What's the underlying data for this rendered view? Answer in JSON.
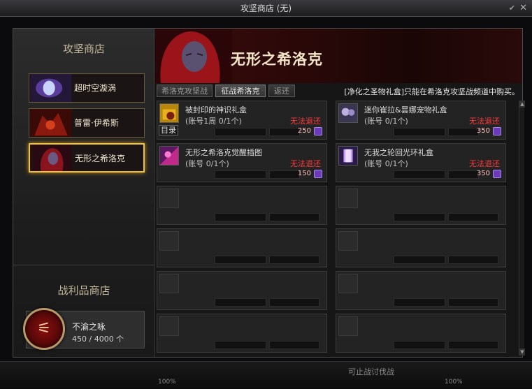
{
  "window": {
    "title": "攻坚商店 (无)"
  },
  "sidebar": {
    "heading": "攻坚商店",
    "shops": [
      {
        "label": "超时空漩涡",
        "active": false
      },
      {
        "label": "普雷·伊希斯",
        "active": false
      },
      {
        "label": "无形之希洛克",
        "active": true
      }
    ],
    "loot_heading": "战利品商店",
    "currency": {
      "name": "不渝之咏",
      "count": "450 / 4000 个"
    }
  },
  "main": {
    "banner_title": "无形之希洛克",
    "tabs": [
      {
        "label": "希洛克攻坚战",
        "active": false
      },
      {
        "label": "征战希洛克",
        "active": true
      },
      {
        "label": "返还",
        "active": false
      }
    ],
    "notice": "[净化之圣物礼盒]只能在希洛克攻坚战频道中购买。",
    "items": [
      {
        "name": "被封印的神识礼盒",
        "limit": "(账号1周 0/1个)",
        "status": "无法退还",
        "price": "250",
        "catalog": "目录",
        "icon": "gift-box-icon"
      },
      {
        "name": "迷你崔拉&昙娜宠物礼盒",
        "limit": "(账号 0/1个)",
        "status": "无法退还",
        "price": "350",
        "catalog": "",
        "icon": "pet-box-icon"
      },
      {
        "name": "无形之希洛克觉醒插图",
        "limit": "(账号 0/1个)",
        "status": "无法退还",
        "price": "150",
        "catalog": "",
        "icon": "illustration-icon"
      },
      {
        "name": "无我之轮回光环礼盒",
        "limit": "(账号 0/1个)",
        "status": "无法退还",
        "price": "350",
        "catalog": "",
        "icon": "aura-box-icon"
      }
    ]
  },
  "footer": {
    "text": "可止战讨伐战",
    "left_pct": "100%",
    "right_pct": "100%"
  },
  "colors": {
    "accent_gold": "#f0c23a",
    "warning_red": "#ff3a3a",
    "currency_purple": "#6a3ab8"
  }
}
